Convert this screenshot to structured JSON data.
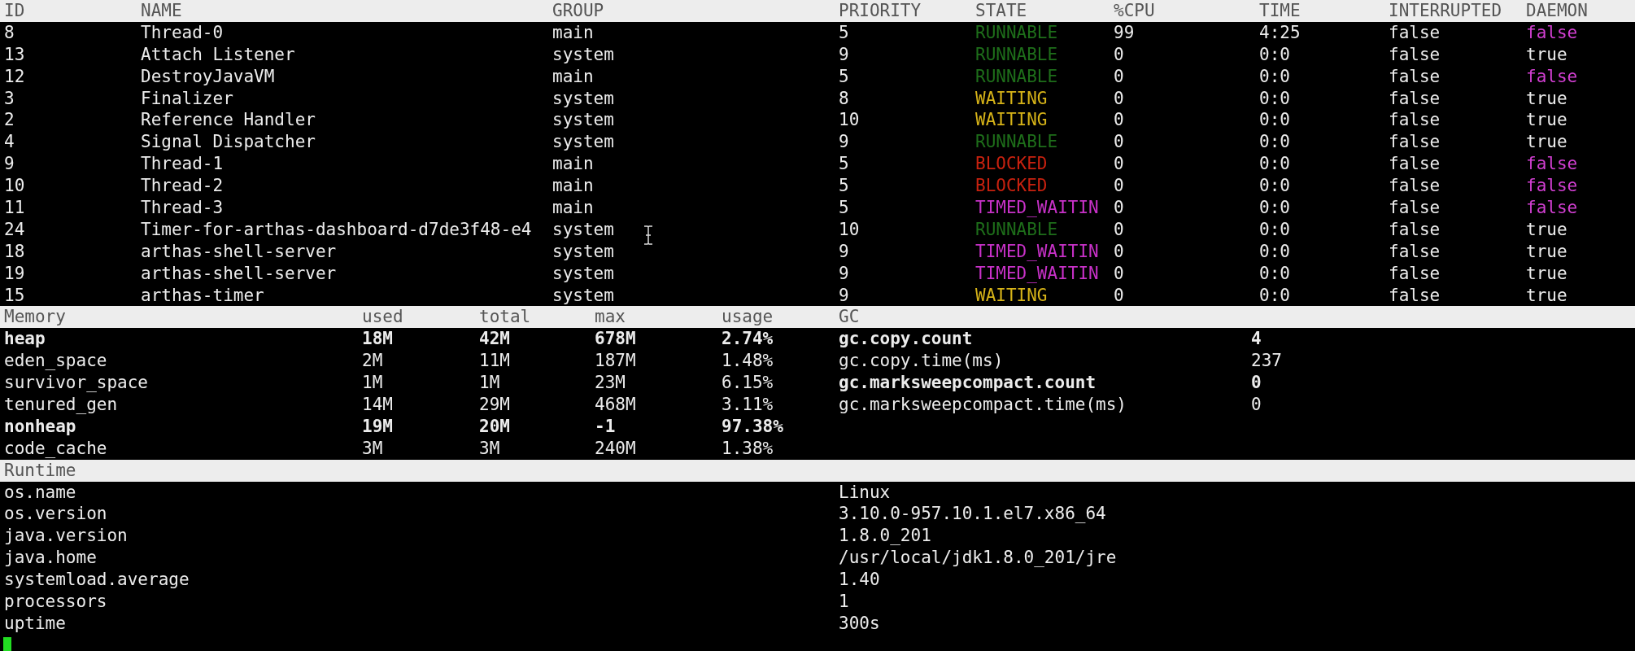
{
  "threads": {
    "columns": [
      "ID",
      "NAME",
      "GROUP",
      "PRIORITY",
      "STATE",
      "%CPU",
      "TIME",
      "INTERRUPTED",
      "DAEMON"
    ],
    "rows": [
      {
        "id": "8",
        "name": "Thread-0",
        "group": "main",
        "priority": "5",
        "state": {
          "text": "RUNNABLE",
          "color": "#1e6e1a"
        },
        "cpu": "99",
        "time": "4:25",
        "interrupted": "false",
        "daemon": {
          "text": "false",
          "color": "#d23fd2"
        }
      },
      {
        "id": "13",
        "name": "Attach Listener",
        "group": "system",
        "priority": "9",
        "state": {
          "text": "RUNNABLE",
          "color": "#1e6e1a"
        },
        "cpu": "0",
        "time": "0:0",
        "interrupted": "false",
        "daemon": {
          "text": "true",
          "color": "#ececec"
        }
      },
      {
        "id": "12",
        "name": "DestroyJavaVM",
        "group": "main",
        "priority": "5",
        "state": {
          "text": "RUNNABLE",
          "color": "#1e6e1a"
        },
        "cpu": "0",
        "time": "0:0",
        "interrupted": "false",
        "daemon": {
          "text": "false",
          "color": "#d23fd2"
        }
      },
      {
        "id": "3",
        "name": "Finalizer",
        "group": "system",
        "priority": "8",
        "state": {
          "text": "WAITING",
          "color": "#d6b318"
        },
        "cpu": "0",
        "time": "0:0",
        "interrupted": "false",
        "daemon": {
          "text": "true",
          "color": "#ececec"
        }
      },
      {
        "id": "2",
        "name": "Reference Handler",
        "group": "system",
        "priority": "10",
        "state": {
          "text": "WAITING",
          "color": "#d6b318"
        },
        "cpu": "0",
        "time": "0:0",
        "interrupted": "false",
        "daemon": {
          "text": "true",
          "color": "#ececec"
        }
      },
      {
        "id": "4",
        "name": "Signal Dispatcher",
        "group": "system",
        "priority": "9",
        "state": {
          "text": "RUNNABLE",
          "color": "#1e6e1a"
        },
        "cpu": "0",
        "time": "0:0",
        "interrupted": "false",
        "daemon": {
          "text": "true",
          "color": "#ececec"
        }
      },
      {
        "id": "9",
        "name": "Thread-1",
        "group": "main",
        "priority": "5",
        "state": {
          "text": "BLOCKED",
          "color": "#c8210f"
        },
        "cpu": "0",
        "time": "0:0",
        "interrupted": "false",
        "daemon": {
          "text": "false",
          "color": "#d23fd2"
        }
      },
      {
        "id": "10",
        "name": "Thread-2",
        "group": "main",
        "priority": "5",
        "state": {
          "text": "BLOCKED",
          "color": "#c8210f"
        },
        "cpu": "0",
        "time": "0:0",
        "interrupted": "false",
        "daemon": {
          "text": "false",
          "color": "#d23fd2"
        }
      },
      {
        "id": "11",
        "name": "Thread-3",
        "group": "main",
        "priority": "5",
        "state": {
          "text": "TIMED_WAITIN",
          "color": "#c831c8"
        },
        "cpu": "0",
        "time": "0:0",
        "interrupted": "false",
        "daemon": {
          "text": "false",
          "color": "#d23fd2"
        }
      },
      {
        "id": "24",
        "name": "Timer-for-arthas-dashboard-d7de3f48-e4",
        "group": "system",
        "priority": "10",
        "state": {
          "text": "RUNNABLE",
          "color": "#1e6e1a"
        },
        "cpu": "0",
        "time": "0:0",
        "interrupted": "false",
        "daemon": {
          "text": "true",
          "color": "#ececec"
        }
      },
      {
        "id": "18",
        "name": "arthas-shell-server",
        "group": "system",
        "priority": "9",
        "state": {
          "text": "TIMED_WAITIN",
          "color": "#c831c8"
        },
        "cpu": "0",
        "time": "0:0",
        "interrupted": "false",
        "daemon": {
          "text": "true",
          "color": "#ececec"
        }
      },
      {
        "id": "19",
        "name": "arthas-shell-server",
        "group": "system",
        "priority": "9",
        "state": {
          "text": "TIMED_WAITIN",
          "color": "#c831c8"
        },
        "cpu": "0",
        "time": "0:0",
        "interrupted": "false",
        "daemon": {
          "text": "true",
          "color": "#ececec"
        }
      },
      {
        "id": "15",
        "name": "arthas-timer",
        "group": "system",
        "priority": "9",
        "state": {
          "text": "WAITING",
          "color": "#d6b318"
        },
        "cpu": "0",
        "time": "0:0",
        "interrupted": "false",
        "daemon": {
          "text": "true",
          "color": "#ececec"
        }
      }
    ]
  },
  "memory": {
    "columns": [
      "Memory",
      "used",
      "total",
      "max",
      "usage"
    ],
    "rows": [
      {
        "name": "heap",
        "used": "18M",
        "total": "42M",
        "max": "678M",
        "usage": "2.74%",
        "bold": true
      },
      {
        "name": "eden_space",
        "used": "2M",
        "total": "11M",
        "max": "187M",
        "usage": "1.48%",
        "bold": false
      },
      {
        "name": "survivor_space",
        "used": "1M",
        "total": "1M",
        "max": "23M",
        "usage": "6.15%",
        "bold": false
      },
      {
        "name": "tenured_gen",
        "used": "14M",
        "total": "29M",
        "max": "468M",
        "usage": "3.11%",
        "bold": false
      },
      {
        "name": "nonheap",
        "used": "19M",
        "total": "20M",
        "max": "-1",
        "usage": "97.38%",
        "bold": true
      },
      {
        "name": "code_cache",
        "used": "3M",
        "total": "3M",
        "max": "240M",
        "usage": "1.38%",
        "bold": false
      }
    ]
  },
  "gc": {
    "title": "GC",
    "rows": [
      {
        "name": "gc.copy.count",
        "value": "4",
        "bold": true
      },
      {
        "name": "gc.copy.time(ms)",
        "value": "237",
        "bold": false
      },
      {
        "name": "gc.marksweepcompact.count",
        "value": "0",
        "bold": true
      },
      {
        "name": "gc.marksweepcompact.time(ms)",
        "value": "0",
        "bold": false
      }
    ]
  },
  "runtime": {
    "title": "Runtime",
    "rows": [
      {
        "name": "os.name",
        "value": "Linux"
      },
      {
        "name": "os.version",
        "value": "3.10.0-957.10.1.el7.x86_64"
      },
      {
        "name": "java.version",
        "value": "1.8.0_201"
      },
      {
        "name": "java.home",
        "value": "/usr/local/jdk1.8.0_201/jre"
      },
      {
        "name": "systemload.average",
        "value": "1.40"
      },
      {
        "name": "processors",
        "value": "1"
      },
      {
        "name": "uptime",
        "value": "300s"
      }
    ]
  }
}
